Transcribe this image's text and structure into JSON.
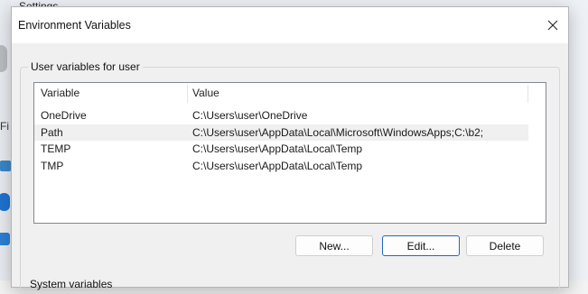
{
  "background": {
    "window_title": "Settings",
    "partial_text": "Fi"
  },
  "dialog": {
    "title": "Environment Variables",
    "close_glyph": "✕",
    "user_group_label": "User variables for user",
    "columns": {
      "variable": "Variable",
      "value": "Value"
    },
    "rows": [
      {
        "variable": "OneDrive",
        "value": "C:\\Users\\user\\OneDrive"
      },
      {
        "variable": "Path",
        "value": "C:\\Users\\user\\AppData\\Local\\Microsoft\\WindowsApps;C:\\b2;"
      },
      {
        "variable": "TEMP",
        "value": "C:\\Users\\user\\AppData\\Local\\Temp"
      },
      {
        "variable": "TMP",
        "value": "C:\\Users\\user\\AppData\\Local\\Temp"
      }
    ],
    "highlighted_row": 1,
    "buttons": {
      "new": "New...",
      "edit": "Edit...",
      "delete": "Delete"
    },
    "system_group_label": "System variables"
  },
  "colors": {
    "accent": "#2167c3",
    "row_highlight": "#f0f0f0"
  }
}
